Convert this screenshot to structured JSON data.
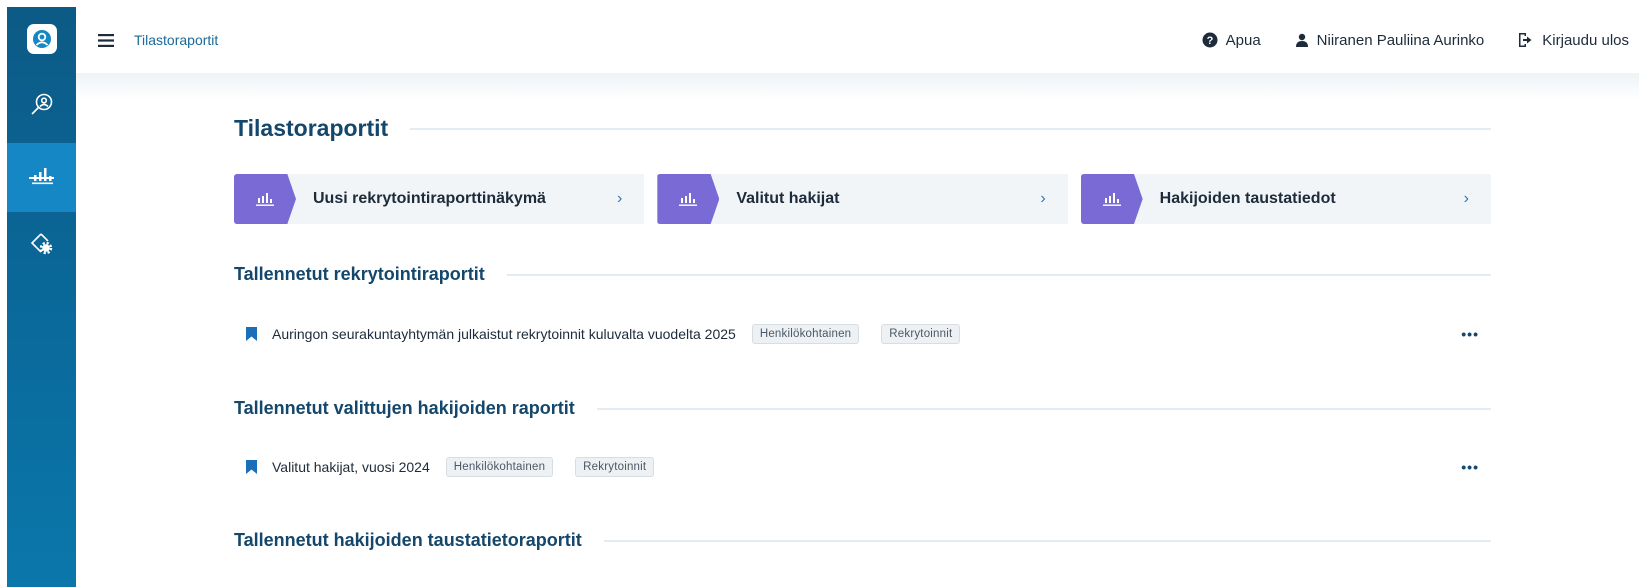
{
  "sidebar": {
    "items": [
      {
        "icon": "logo-icon"
      },
      {
        "icon": "search-person-icon"
      },
      {
        "icon": "bar-chart-icon",
        "active": true
      },
      {
        "icon": "settings-diamond-icon"
      }
    ]
  },
  "topbar": {
    "breadcrumb": "Tilastoraportit",
    "help_label": "Apua",
    "user_name": "Niiranen Pauliina Aurinko",
    "logout_label": "Kirjaudu ulos"
  },
  "page": {
    "title": "Tilastoraportit",
    "cards": [
      {
        "label": "Uusi rekrytointiraporttinäkymä",
        "icon": "bar-chart-icon"
      },
      {
        "label": "Valitut hakijat",
        "icon": "bar-chart-icon"
      },
      {
        "label": "Hakijoiden taustatiedot",
        "icon": "bar-chart-icon"
      }
    ],
    "sections": [
      {
        "title": "Tallennetut rekrytointiraportit",
        "reports": [
          {
            "name": "Auringon seurakuntayhtymän julkaistut rekrytoinnit kuluvalta vuodelta 2025",
            "tags": [
              "Henkilökohtainen",
              "Rekrytoinnit"
            ]
          }
        ]
      },
      {
        "title": "Tallennetut valittujen hakijoiden raportit",
        "reports": [
          {
            "name": "Valitut hakijat, vuosi 2024",
            "tags": [
              "Henkilökohtainen",
              "Rekrytoinnit"
            ]
          }
        ]
      },
      {
        "title": "Tallennetut hakijoiden taustatietoraportit",
        "reports": []
      }
    ],
    "more_label": "•••"
  },
  "colors": {
    "sidebar": "#0c5a86",
    "sidebar_active": "#1487c4",
    "card_icon": "#7a6ad6",
    "heading": "#14476c"
  }
}
